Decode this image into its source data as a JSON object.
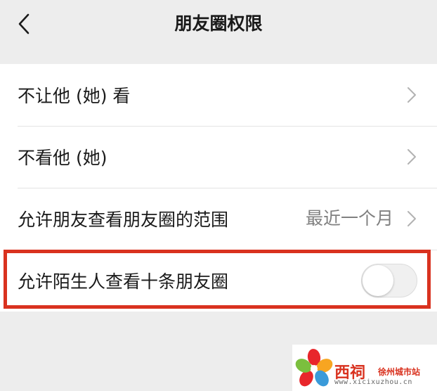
{
  "navbar": {
    "title": "朋友圈权限"
  },
  "rows": [
    {
      "label": "不让他 (她) 看"
    },
    {
      "label": "不看他 (她)"
    },
    {
      "label": "允许朋友查看朋友圈的范围",
      "value": "最近一个月"
    },
    {
      "label": "允许陌生人查看十条朋友圈",
      "toggle_on": false
    }
  ],
  "colors": {
    "background": "#ededed",
    "cell": "#ffffff",
    "highlight": "#d9321f",
    "secondary_text": "#808080"
  },
  "watermark": {
    "brand": "西祠",
    "sub": "徐州城市站",
    "url": "www.xicixuzhou.cn"
  }
}
